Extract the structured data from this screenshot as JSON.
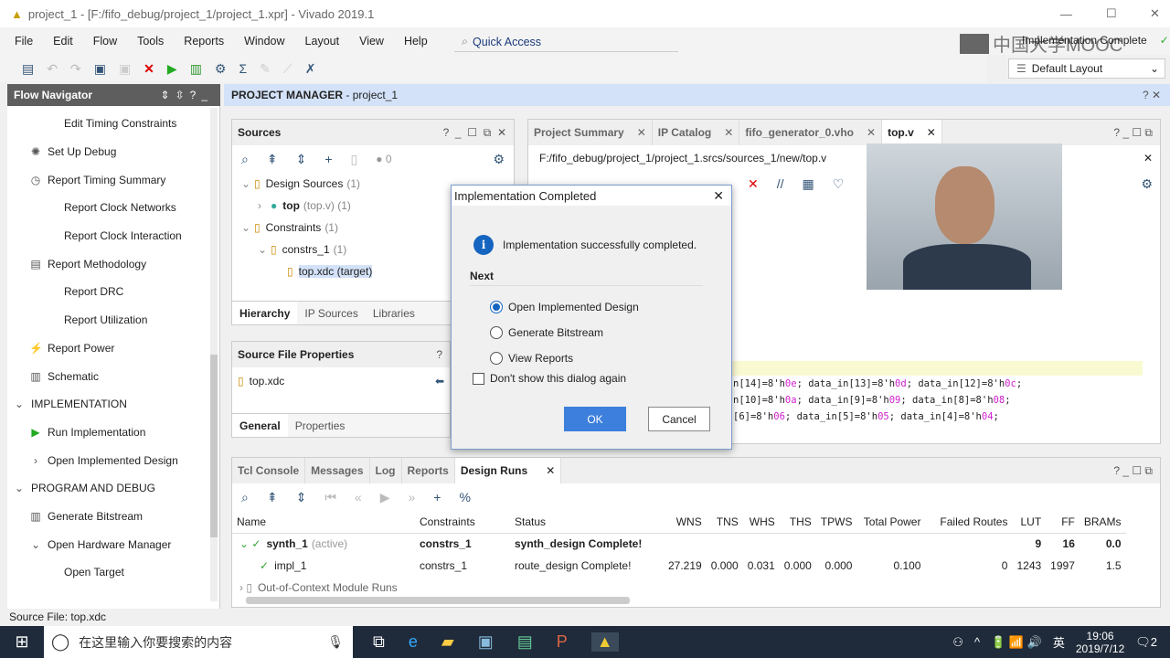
{
  "window": {
    "title": "project_1 - [F:/fifo_debug/project_1/project_1.xpr] - Vivado 2019.1"
  },
  "menu": [
    "File",
    "Edit",
    "Flow",
    "Tools",
    "Reports",
    "Window",
    "Layout",
    "View",
    "Help"
  ],
  "quick_access": "Quick Access",
  "watermark": "中国大学MOOC",
  "status_right": "Implementation Complete",
  "layout_select": "Default Layout",
  "flow_navigator": {
    "title": "Flow Navigator",
    "items": [
      {
        "label": "Edit Timing Constraints",
        "icon": "none",
        "indent": 2
      },
      {
        "label": "Set Up Debug",
        "icon": "debug-icon",
        "indent": 1
      },
      {
        "label": "Report Timing Summary",
        "icon": "timer-icon",
        "indent": 1
      },
      {
        "label": "Report Clock Networks",
        "icon": "none",
        "indent": 2
      },
      {
        "label": "Report Clock Interaction",
        "icon": "none",
        "indent": 2
      },
      {
        "label": "Report Methodology",
        "icon": "doc-icon",
        "indent": 1
      },
      {
        "label": "Report DRC",
        "icon": "none",
        "indent": 2
      },
      {
        "label": "Report Utilization",
        "icon": "none",
        "indent": 2
      },
      {
        "label": "Report Power",
        "icon": "power-icon",
        "indent": 1
      },
      {
        "label": "Schematic",
        "icon": "schematic-icon",
        "indent": 1
      },
      {
        "label": "IMPLEMENTATION",
        "icon": "chevron-down-icon",
        "indent": 0
      },
      {
        "label": "Run Implementation",
        "icon": "play-icon",
        "indent": 1
      },
      {
        "label": "Open Implemented Design",
        "icon": "chevron-right-icon",
        "indent": 1
      },
      {
        "label": "PROGRAM AND DEBUG",
        "icon": "chevron-down-icon",
        "indent": 0
      },
      {
        "label": "Generate Bitstream",
        "icon": "bitstream-icon",
        "indent": 1
      },
      {
        "label": "Open Hardware Manager",
        "icon": "chevron-down-icon",
        "indent": 1
      },
      {
        "label": "Open Target",
        "icon": "none",
        "indent": 2
      }
    ]
  },
  "project_manager": {
    "title": "PROJECT MANAGER",
    "project": "- project_1"
  },
  "sources": {
    "title": "Sources",
    "count": "0",
    "tree": [
      {
        "label": "Design Sources",
        "suffix": "(1)",
        "level": 0
      },
      {
        "label": "top",
        "suffix": "(top.v) (1)",
        "level": 1
      },
      {
        "label": "Constraints",
        "suffix": "(1)",
        "level": 0
      },
      {
        "label": "constrs_1",
        "suffix": "(1)",
        "level": 1
      },
      {
        "label": "top.xdc (target)",
        "suffix": "",
        "level": 2
      }
    ],
    "tabs": [
      "Hierarchy",
      "IP Sources",
      "Libraries"
    ]
  },
  "source_props": {
    "title": "Source File Properties",
    "file": "top.xdc",
    "tabs": [
      "General",
      "Properties"
    ]
  },
  "editor": {
    "tabs": [
      "Project Summary",
      "IP Catalog",
      "fifo_generator_0.vho",
      "top.v"
    ],
    "path": "F:/fifo_debug/project_1/project_1.srcs/sources_1/new/top.v",
    "lines": [
      [
        [
          "n[14]=8'h",
          ""
        ],
        [
          "0e",
          "m"
        ],
        [
          "; data_in[13]=8'h",
          ""
        ],
        [
          "0d",
          "m"
        ],
        [
          "; data_in[12]=8'h",
          ""
        ],
        [
          "0c",
          "m"
        ],
        [
          ";",
          ""
        ]
      ],
      [
        [
          "n[10]=8'h",
          ""
        ],
        [
          "0a",
          "m"
        ],
        [
          "; data_in[9]=8'h",
          ""
        ],
        [
          "09",
          "m"
        ],
        [
          "; data_in[8]=8'h",
          ""
        ],
        [
          "08",
          "m"
        ],
        [
          ";",
          ""
        ]
      ],
      [
        [
          "[6]=8'h",
          ""
        ],
        [
          "06",
          "m"
        ],
        [
          "; data_in[5]=8'h",
          ""
        ],
        [
          "05",
          "m"
        ],
        [
          "; data_in[4]=8'h",
          ""
        ],
        [
          "04",
          "m"
        ],
        [
          ";",
          ""
        ]
      ]
    ]
  },
  "dialog": {
    "title": "Implementation Completed",
    "message": "Implementation successfully completed.",
    "next": "Next",
    "options": [
      "Open Implemented Design",
      "Generate Bitstream",
      "View Reports"
    ],
    "selected": 0,
    "dont_show": "Don't show this dialog again",
    "ok": "OK",
    "cancel": "Cancel"
  },
  "bottom": {
    "tabs": [
      "Tcl Console",
      "Messages",
      "Log",
      "Reports",
      "Design Runs"
    ],
    "active": "Design Runs",
    "columns": [
      "Name",
      "Constraints",
      "Status",
      "WNS",
      "TNS",
      "WHS",
      "THS",
      "TPWS",
      "Total Power",
      "Failed Routes",
      "LUT",
      "FF",
      "BRAMs"
    ],
    "rows": [
      {
        "name": "synth_1",
        "tag": "(active)",
        "cells": [
          "constrs_1",
          "synth_design Complete!",
          "",
          "",
          "",
          "",
          "",
          "",
          "",
          "9",
          "16",
          "0.0"
        ],
        "bold": true
      },
      {
        "name": "impl_1",
        "tag": "",
        "cells": [
          "constrs_1",
          "route_design Complete!",
          "27.219",
          "0.000",
          "0.031",
          "0.000",
          "0.000",
          "0.100",
          "0",
          "1243",
          "1997",
          "1.5"
        ],
        "bold": false
      },
      {
        "name": "Out-of-Context Module Runs",
        "tag": "",
        "cells": [],
        "bold": false
      }
    ]
  },
  "statusbar": "Source File: top.xdc",
  "taskbar": {
    "search": "在这里输入你要搜索的内容",
    "time": "19:06",
    "date": "2019/7/12",
    "ime": "英",
    "notifications": "2"
  }
}
